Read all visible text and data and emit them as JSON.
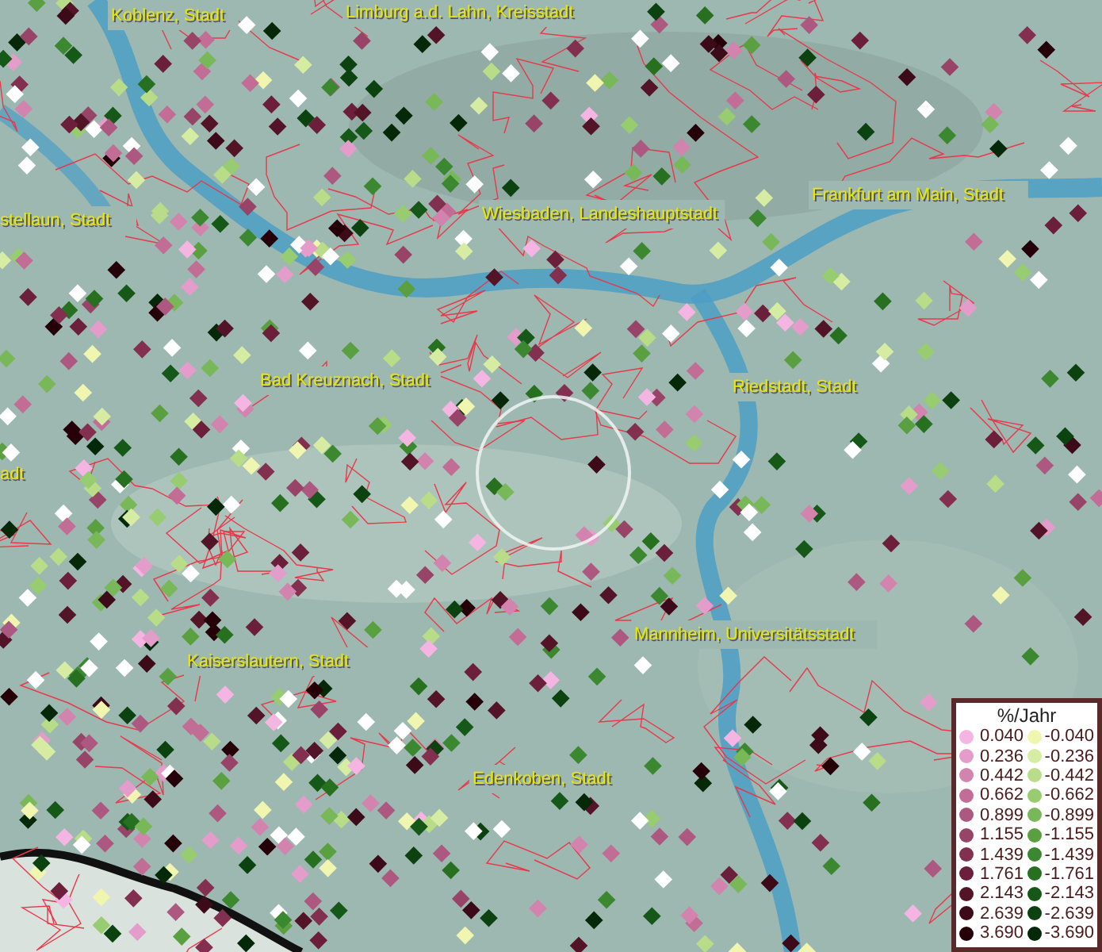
{
  "map_labels": [
    {
      "text": "Koblenz, Stadt"
    },
    {
      "text": "Limburg a.d. Lahn, Kreisstadt"
    },
    {
      "text": "stellaun, Stadt"
    },
    {
      "text": "Wiesbaden, Landeshauptstadt"
    },
    {
      "text": "Frankfurt am Main, Stadt"
    },
    {
      "text": "Bad Kreuznach, Stadt"
    },
    {
      "text": "Riedstadt, Stadt"
    },
    {
      "text": "adt"
    },
    {
      "text": "Mannheim, Universitätsstadt"
    },
    {
      "text": "Kaiserslautern, Stadt"
    },
    {
      "text": "Edenkoben, Stadt"
    }
  ],
  "legend": {
    "title": "%/Jahr",
    "rows": [
      {
        "positive": {
          "value": "0.040",
          "color": "#f5b5e3"
        },
        "negative": {
          "value": "-0.040",
          "color": "#f0f5b0"
        }
      },
      {
        "positive": {
          "value": "0.236",
          "color": "#e49ccb"
        },
        "negative": {
          "value": "-0.236",
          "color": "#d6eca2"
        }
      },
      {
        "positive": {
          "value": "0.442",
          "color": "#d283ae"
        },
        "negative": {
          "value": "-0.442",
          "color": "#b8dc88"
        }
      },
      {
        "positive": {
          "value": "0.662",
          "color": "#c26d96"
        },
        "negative": {
          "value": "-0.662",
          "color": "#98cc70"
        }
      },
      {
        "positive": {
          "value": "0.899",
          "color": "#ad5880"
        },
        "negative": {
          "value": "-0.899",
          "color": "#78b858"
        }
      },
      {
        "positive": {
          "value": "1.155",
          "color": "#984468"
        },
        "negative": {
          "value": "-1.155",
          "color": "#5aa040"
        }
      },
      {
        "positive": {
          "value": "1.439",
          "color": "#833050"
        },
        "negative": {
          "value": "-1.439",
          "color": "#3c8830"
        }
      },
      {
        "positive": {
          "value": "1.761",
          "color": "#6c1f3a"
        },
        "negative": {
          "value": "-1.761",
          "color": "#267020"
        }
      },
      {
        "positive": {
          "value": "2.143",
          "color": "#541428"
        },
        "negative": {
          "value": "-2.143",
          "color": "#155818"
        }
      },
      {
        "positive": {
          "value": "2.639",
          "color": "#3c0a18"
        },
        "negative": {
          "value": "-2.639",
          "color": "#0b4210"
        }
      },
      {
        "positive": {
          "value": "3.690",
          "color": "#260008"
        },
        "negative": {
          "value": "-3.690",
          "color": "#042808"
        }
      }
    ]
  }
}
